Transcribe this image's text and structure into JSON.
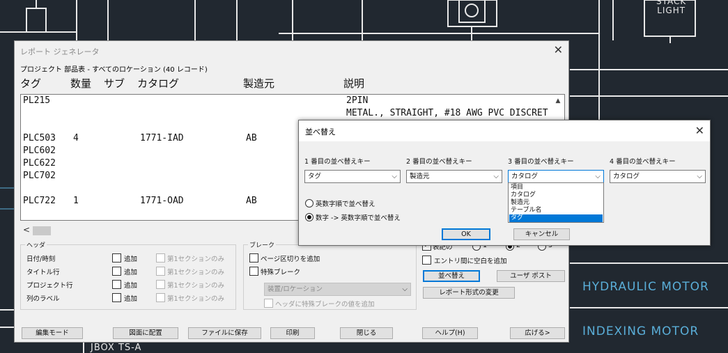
{
  "cad": {
    "stack_light": [
      "STACK",
      "LIGHT"
    ],
    "hydraulic_motor": "HYDRAULIC  MOTOR",
    "indexing_motor": "INDEXING  MOTOR",
    "jbox": "JBOX  TS-A",
    "label_color": "#5aaed8"
  },
  "report": {
    "title": "レポート ジェネレータ",
    "close": "✕",
    "caption": "プロジェクト 部品表 - すべてのロケーション (40 レコード)",
    "columns": [
      "タグ",
      "数量",
      "サブ",
      "カタログ",
      "製造元",
      "説明"
    ],
    "rows": [
      {
        "tag": "PL215",
        "qty": "",
        "catalog": "",
        "mfr": "",
        "desc": [
          "2PIN",
          "METAL., STRAIGHT, #18 AWG PVC DISCRET"
        ]
      },
      {
        "tag": "PLC503",
        "qty": "4",
        "catalog": "1771-IAD",
        "mfr": "AB"
      },
      {
        "tag": "PLC602"
      },
      {
        "tag": "PLC622"
      },
      {
        "tag": "PLC702"
      },
      {
        "tag": "PLC722",
        "qty": "1",
        "catalog": "1771-OAD",
        "mfr": "AB"
      }
    ],
    "scroll_left_icon": "<",
    "scroll_up_icon": "▲",
    "header_group": {
      "title": "ヘッダ",
      "items": [
        {
          "label": "日付/時刻",
          "add": "追加",
          "first_only": "第1セクションのみ"
        },
        {
          "label": "タイトル行",
          "add": "追加",
          "first_only": "第1セクションのみ"
        },
        {
          "label": "プロジェクト行",
          "add": "追加",
          "first_only": "第1セクションのみ"
        },
        {
          "label": "列のラベル",
          "add": "追加",
          "first_only": "第1セクションのみ"
        }
      ]
    },
    "break_group": {
      "title": "ブレーク",
      "page_break": "ページ区切りを追加",
      "special_break": "特殊ブレーク",
      "location_combo": "装置/ロケーション",
      "header_special": "ヘッダに特殊ブレークの値を追加"
    },
    "right_panel": {
      "num_lines_partial": "表記の",
      "radio_labels": [
        "1",
        "2",
        "3"
      ],
      "radio_selected": 1,
      "blank_between": "エントリ間に空白を追加",
      "sort_button": "並べ替え",
      "user_post": "ユーザ ポスト",
      "change_format": "レポート形式の変更"
    },
    "bottom_buttons": [
      "編集モード",
      "図面に配置",
      "ファイルに保存",
      "印刷",
      "閉じる",
      "ヘルプ(H)",
      "広げる>"
    ]
  },
  "sort_dialog": {
    "title": "並べ替え",
    "close": "✕",
    "key_labels": [
      "1 番目の並べ替えキー",
      "2 番目の並べ替えキー",
      "3 番目の並べ替えキー",
      "4 番目の並べ替えキー"
    ],
    "key_values": [
      "タグ",
      "製造元",
      "カタログ",
      "カタログ"
    ],
    "dropdown_options": [
      "項目",
      "カタログ",
      "製造元",
      "テーブル名",
      "タグ"
    ],
    "dropdown_selected": 4,
    "radio_options": [
      "英数字順で並べ替え",
      "数字 -> 英数字順で並べ替え"
    ],
    "radio_selected": 1,
    "ok": "OK",
    "cancel": "キャンセル"
  }
}
